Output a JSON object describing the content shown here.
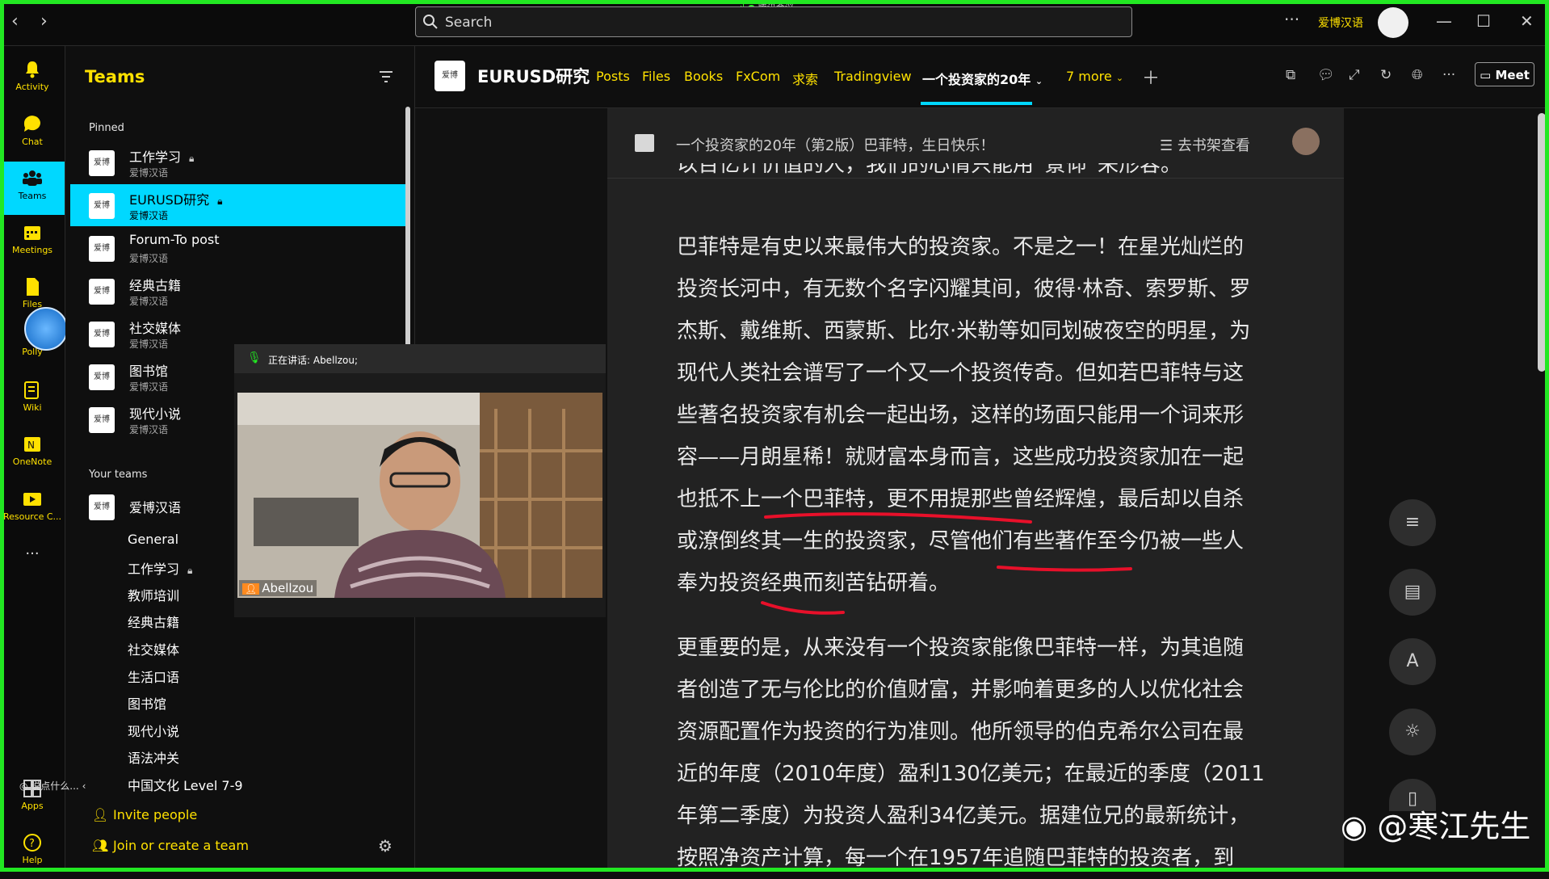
{
  "window": {
    "search_placeholder": "Search",
    "meeting_tag": "腾讯会议",
    "org_name": "爱博汉语",
    "more_glyph": "···",
    "minimize": "—",
    "maximize": "☐",
    "close": "✕"
  },
  "rail": [
    {
      "label": "Activity",
      "icon": "bell-icon"
    },
    {
      "label": "Chat",
      "icon": "chat-icon"
    },
    {
      "label": "Teams",
      "icon": "teams-icon",
      "active": true
    },
    {
      "label": "Meetings",
      "icon": "calendar-icon"
    },
    {
      "label": "Files",
      "icon": "file-icon"
    },
    {
      "label": "Polly",
      "icon": "polly-icon"
    },
    {
      "label": "Wiki",
      "icon": "wiki-icon"
    },
    {
      "label": "OneNote",
      "icon": "onenote-icon"
    },
    {
      "label": "Resource C...",
      "icon": "resource-icon"
    },
    {
      "label": "···",
      "icon": "more-icon"
    },
    {
      "label": "Apps",
      "icon": "apps-icon"
    },
    {
      "label": "Help",
      "icon": "help-icon"
    }
  ],
  "teams_panel": {
    "title": "Teams",
    "pinned_label": "Pinned",
    "pinned": [
      {
        "name": "工作学习",
        "sub": "爱博汉语",
        "locked": true
      },
      {
        "name": "EURUSD研究",
        "sub": "爱博汉语",
        "locked": true,
        "selected": true
      },
      {
        "name": "Forum-To post",
        "sub": "爱博汉语"
      },
      {
        "name": "经典古籍",
        "sub": "爱博汉语"
      },
      {
        "name": "社交媒体",
        "sub": "爱博汉语"
      },
      {
        "name": "图书馆",
        "sub": "爱博汉语"
      },
      {
        "name": "现代小说",
        "sub": "爱博汉语"
      }
    ],
    "your_teams_label": "Your teams",
    "team": {
      "name": "爱博汉语"
    },
    "channels": [
      "General",
      "工作学习",
      "教师培训",
      "经典古籍",
      "社交媒体",
      "生活口语",
      "图书馆",
      "现代小说",
      "语法冲关",
      "中国文化 Level 7-9"
    ],
    "invite": "Invite people",
    "join": "Join or create a team",
    "say_tag": "说点什么..."
  },
  "video": {
    "speaking": "正在讲话: Abellzou;",
    "name": "Abellzou"
  },
  "channel_header": {
    "title": "EURUSD研究",
    "tabs": [
      "Posts",
      "Files",
      "Books",
      "FxCom",
      "求索",
      "Tradingview",
      "一个投资家的20年",
      "7 more"
    ],
    "active_tab": "一个投资家的20年",
    "meet": "Meet"
  },
  "reader": {
    "book_title": "一个投资家的20年（第2版）巴菲特，生日快乐！",
    "shelf_link": "去书架查看",
    "top_partial": "以百亿计价值的人，我们的心情只能用“景仰”来形容。",
    "para1": [
      "巴菲特是有史以来最伟大的投资家。不是之一！在星光灿烂的",
      "投资长河中，有无数个名字闪耀其间，彼得·林奇、索罗斯、罗",
      "杰斯、戴维斯、西蒙斯、比尔·米勒等如同划破夜空的明星，为",
      "现代人类社会谱写了一个又一个投资传奇。但如若巴菲特与这",
      "些著名投资家有机会一起出场，这样的场面只能用一个词来形",
      "容——月朗星稀！就财富本身而言，这些成功投资家加在一起",
      "也抵不上一个巴菲特，更不用提那些曾经辉煌，最后却以自杀",
      "或潦倒终其一生的投资家，尽管他们有些著作至今仍被一些人",
      "奉为投资经典而刻苦钻研着。"
    ],
    "para2": [
      "更重要的是，从来没有一个投资家能像巴菲特一样，为其追随",
      "者创造了无与伦比的价值财富，并影响着更多的人以优化社会",
      "资源配置作为投资的行为准则。他所领导的伯克希尔公司在最",
      "近的年度（2010年度）盈利130亿美元；在最近的季度（2011",
      "年第二季度）为投资人盈利34亿美元。据建位兄的最新统计，",
      "按照净资产计算，每一个在1957年追随巴菲特的投资者，到"
    ],
    "fab_glyphs": [
      "≡",
      "▤",
      "A",
      "☼",
      "▯"
    ]
  },
  "watermark": "@寒江先生",
  "colors": {
    "accent_yellow": "#ffe100",
    "accent_cyan": "#00d8ff",
    "border_green": "#22e822",
    "underline_red": "#e8102a"
  }
}
